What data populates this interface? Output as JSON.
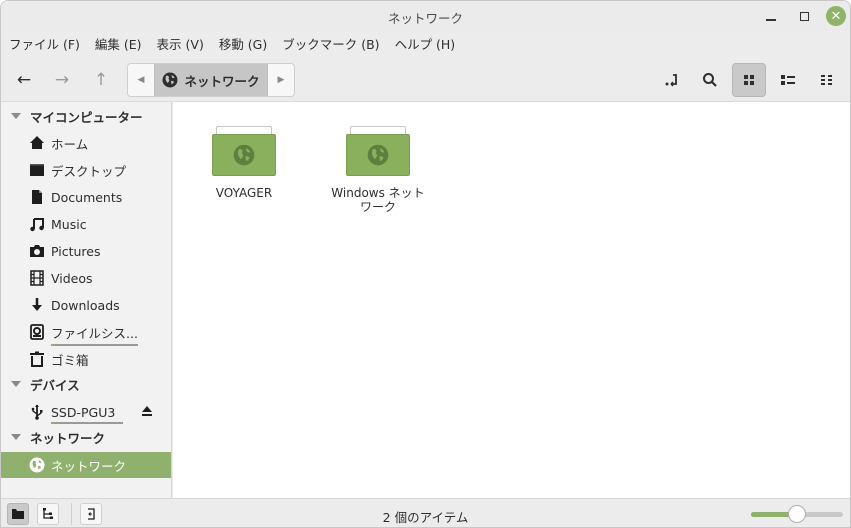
{
  "window": {
    "title": "ネットワーク",
    "controls": {
      "minimize": "minimize-icon",
      "maximize": "maximize-icon",
      "close": "close-icon"
    }
  },
  "menubar": {
    "items": [
      "ファイル (F)",
      "編集 (E)",
      "表示 (V)",
      "移動 (G)",
      "ブックマーク (B)",
      "ヘルプ (H)"
    ]
  },
  "toolbar": {
    "back": "←",
    "forward": "→",
    "up": "↑",
    "path": {
      "left_arrow": "◀",
      "current": "ネットワーク",
      "right_arrow": "▶",
      "icon": "globe-icon"
    },
    "toggle_location": "location-toggle-icon",
    "search": "search-icon",
    "views": [
      {
        "name": "icon-view",
        "active": true
      },
      {
        "name": "list-view",
        "active": false
      },
      {
        "name": "compact-view",
        "active": false
      }
    ]
  },
  "sidebar": {
    "sections": [
      {
        "heading": "マイコンピューター",
        "items": [
          {
            "label": "ホーム",
            "icon": "home-icon"
          },
          {
            "label": "デスクトップ",
            "icon": "desktop-icon"
          },
          {
            "label": "Documents",
            "icon": "document-icon"
          },
          {
            "label": "Music",
            "icon": "music-icon"
          },
          {
            "label": "Pictures",
            "icon": "camera-icon"
          },
          {
            "label": "Videos",
            "icon": "film-icon"
          },
          {
            "label": "Downloads",
            "icon": "download-icon"
          },
          {
            "label": "ファイルシス...",
            "icon": "harddisk-icon",
            "usage_fraction": 0.05
          },
          {
            "label": "ゴミ箱",
            "icon": "trash-icon"
          }
        ]
      },
      {
        "heading": "デバイス",
        "items": [
          {
            "label": "SSD-PGU3",
            "icon": "usb-icon",
            "eject": "eject-icon",
            "usage_fraction": 0.05
          }
        ]
      },
      {
        "heading": "ネットワーク",
        "items": [
          {
            "label": "ネットワーク",
            "icon": "globe-icon",
            "selected": true
          }
        ]
      }
    ]
  },
  "content": {
    "items": [
      {
        "label": "VOYAGER",
        "icon": "network-folder-icon"
      },
      {
        "label": "Windows ネットワーク",
        "icon": "network-folder-icon"
      }
    ]
  },
  "statusbar": {
    "text": "2 個のアイテム",
    "zoom_fraction": 0.5,
    "buttons": [
      "places-icon",
      "tree-icon",
      "toggle-sidebar-icon"
    ]
  },
  "colors": {
    "accent": "#8fb16d",
    "folder": "#8ab05e"
  }
}
